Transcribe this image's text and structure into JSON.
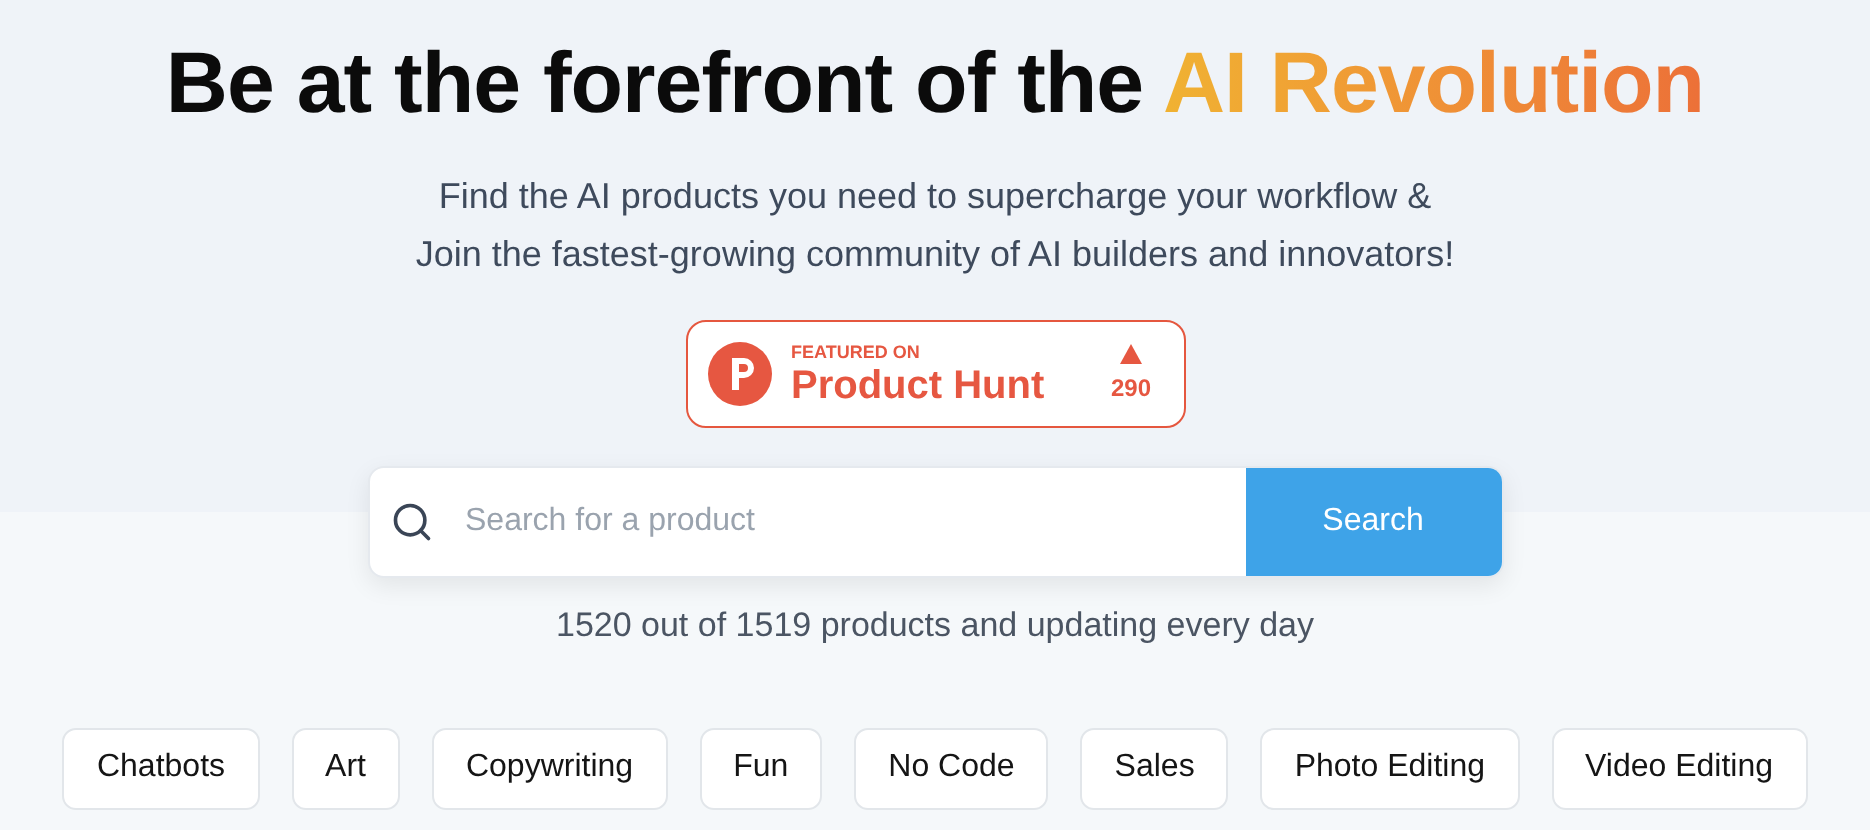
{
  "hero": {
    "title": "Be at the forefront of the",
    "title_highlight": "AI Revolution",
    "subtitle_lines": [
      "Find the AI products you need to supercharge your workflow &",
      "Join the fastest-growing community of AI builders and innovators!"
    ]
  },
  "badge": {
    "kicker": "FEATURED ON",
    "name": "Product Hunt",
    "votes": "290"
  },
  "search": {
    "placeholder": "Search for a product",
    "button": "Search"
  },
  "count_text": "1520 out of 1519 products and updating every day",
  "categories": [
    "Chatbots",
    "Art",
    "Copywriting",
    "Fun",
    "No Code",
    "Sales",
    "Photo Editing",
    "Video Editing"
  ]
}
